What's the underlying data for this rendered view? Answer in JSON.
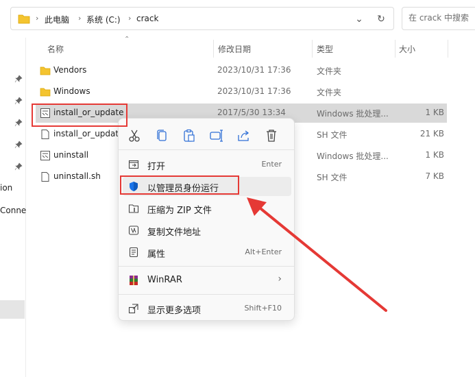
{
  "breadcrumb": {
    "items": [
      "此电脑",
      "系统 (C:)",
      "crack"
    ]
  },
  "search": {
    "placeholder": "在 crack 中搜索"
  },
  "nav": {
    "partial_items": [
      "ion",
      "Conne"
    ]
  },
  "columns": {
    "name": "名称",
    "date": "修改日期",
    "type": "类型",
    "size": "大小"
  },
  "files": [
    {
      "name": "Vendors",
      "date": "2023/10/31 17:36",
      "type": "文件夹",
      "size": "",
      "icon": "folder-icon"
    },
    {
      "name": "Windows",
      "date": "2023/10/31 17:36",
      "type": "文件夹",
      "size": "",
      "icon": "folder-icon"
    },
    {
      "name": "install_or_update",
      "date": "2017/5/30 13:34",
      "type": "Windows 批处理...",
      "size": "1 KB",
      "icon": "batch-file-icon"
    },
    {
      "name": "install_or_update",
      "date": "",
      "type": "SH 文件",
      "size": "21 KB",
      "icon": "file-icon"
    },
    {
      "name": "uninstall",
      "date": "",
      "type": "Windows 批处理...",
      "size": "1 KB",
      "icon": "batch-file-icon"
    },
    {
      "name": "uninstall.sh",
      "date": "",
      "type": "SH 文件",
      "size": "7 KB",
      "icon": "file-icon"
    }
  ],
  "context_menu": {
    "quick_actions": [
      "cut-icon",
      "copy-icon",
      "paste-icon",
      "rename-icon",
      "share-icon",
      "delete-icon"
    ],
    "items": [
      {
        "label": "打开",
        "shortcut": "Enter",
        "icon": "open-icon"
      },
      {
        "label": "以管理员身份运行",
        "shortcut": "",
        "icon": "shield-icon"
      },
      {
        "label": "压缩为 ZIP 文件",
        "shortcut": "",
        "icon": "zip-icon"
      },
      {
        "label": "复制文件地址",
        "shortcut": "",
        "icon": "copy-path-icon"
      },
      {
        "label": "属性",
        "shortcut": "Alt+Enter",
        "icon": "properties-icon"
      },
      {
        "label": "WinRAR",
        "shortcut": "",
        "icon": "winrar-icon"
      },
      {
        "label": "显示更多选项",
        "shortcut": "Shift+F10",
        "icon": "more-options-icon"
      }
    ]
  },
  "colors": {
    "selection": "#d9d9d9",
    "annotation_red": "#e53935",
    "shield_blue": "#1a73e8"
  }
}
